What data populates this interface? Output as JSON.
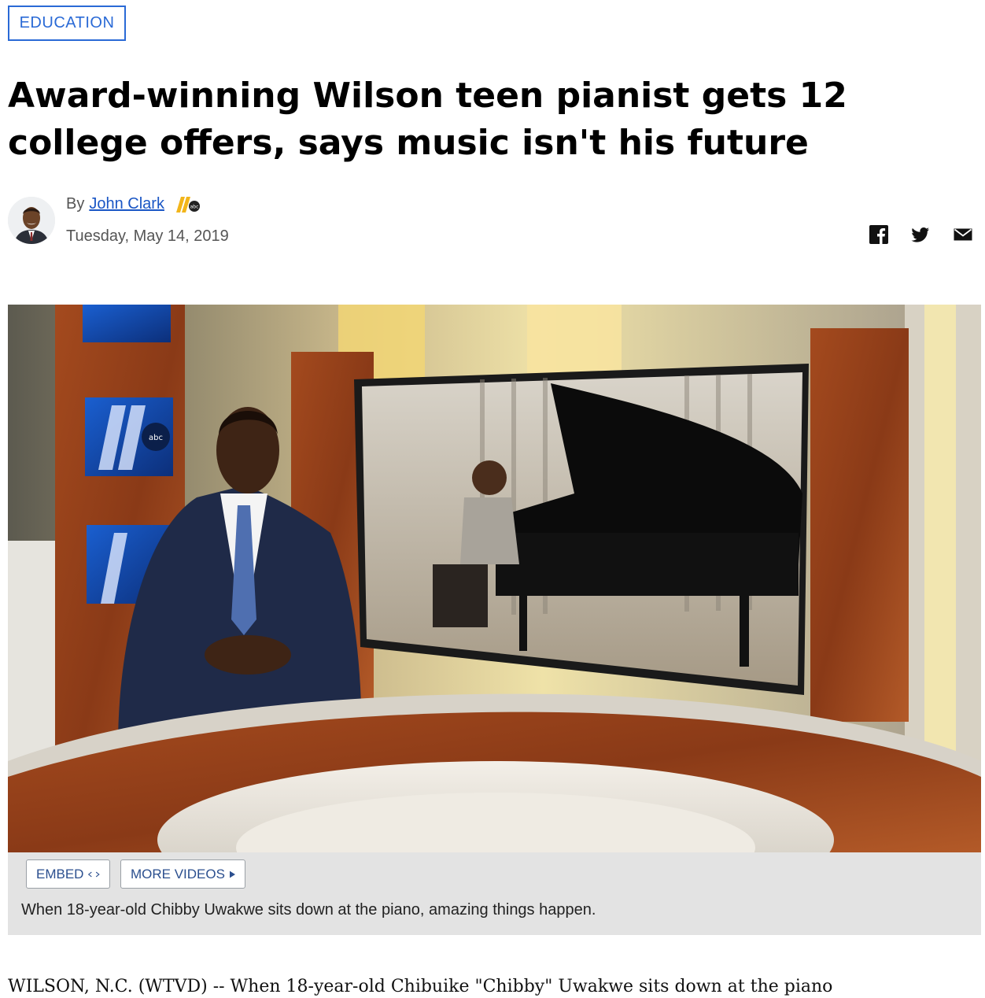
{
  "article": {
    "category": "EDUCATION",
    "headline": "Award-winning Wilson teen pianist gets 12 college offers, says music isn't his future",
    "byline_prefix": "By",
    "author": "John Clark",
    "station_logo": "11 abc",
    "date": "Tuesday, May 14, 2019"
  },
  "share": {
    "icons": [
      "facebook-icon",
      "twitter-icon",
      "email-icon"
    ]
  },
  "video": {
    "embed_label": "EMBED",
    "more_label": "MORE VIDEOS",
    "caption": "When 18-year-old Chibby Uwakwe sits down at the piano, amazing things happen."
  },
  "body": {
    "lead": "WILSON, N.C. (WTVD) -- When 18-year-old Chibuike \"Chibby\" Uwakwe sits down at the piano"
  },
  "colors": {
    "accent": "#2a6ad6",
    "link": "#1a56c5",
    "caption_bg": "#e3e3e3",
    "button_text": "#2b4f8f"
  }
}
